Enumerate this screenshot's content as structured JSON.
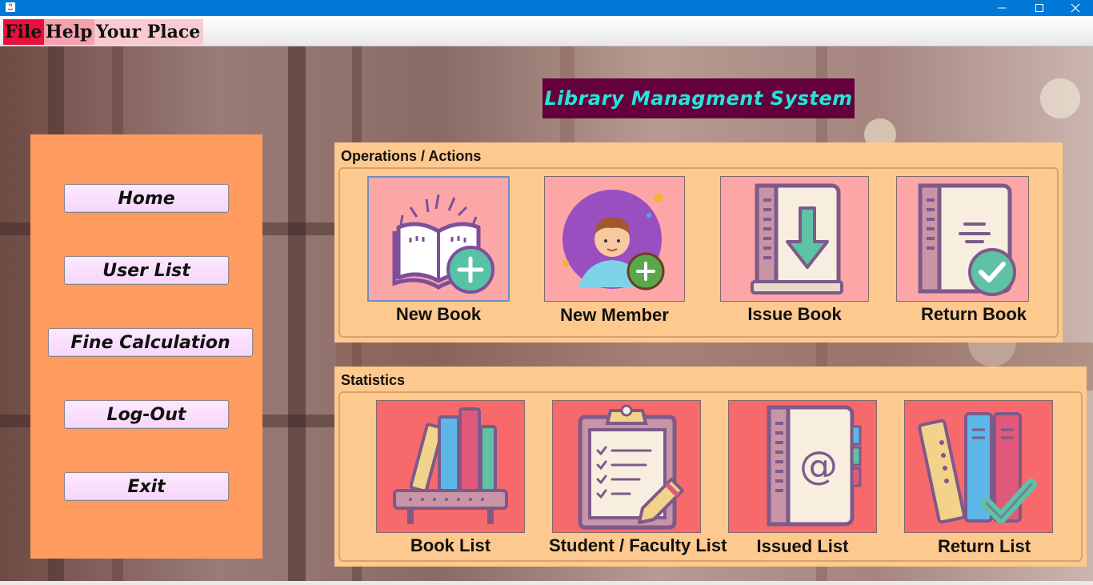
{
  "window": {
    "min_glyph": "—",
    "max_glyph": "☐",
    "close_glyph": "✕"
  },
  "menu": {
    "file": "File",
    "help": "Help",
    "your_place": "Your Place"
  },
  "app_title": "Library Managment System",
  "sidebar": {
    "home": "Home",
    "user_list": "User List",
    "fine_calculation": "Fine Calculation",
    "logout": "Log-Out",
    "exit": "Exit"
  },
  "operations": {
    "title": "Operations  /  Actions",
    "tiles": [
      {
        "label": "New Book",
        "icon": "new-book-icon"
      },
      {
        "label": "New Member",
        "icon": "new-member-icon"
      },
      {
        "label": "Issue Book",
        "icon": "issue-book-icon"
      },
      {
        "label": "Return Book",
        "icon": "return-book-icon"
      }
    ]
  },
  "statistics": {
    "title": "Statistics",
    "tiles": [
      {
        "label": "Book List",
        "icon": "book-list-icon"
      },
      {
        "label": "Student / Faculty List",
        "icon": "clipboard-list-icon"
      },
      {
        "label": "Issued List",
        "icon": "issued-list-icon"
      },
      {
        "label": "Return List",
        "icon": "return-list-icon"
      }
    ]
  },
  "colors": {
    "titlebar": "#0078d7",
    "sidebar": "#ff9b5f",
    "panel": "#fec98f",
    "title_bg": "#64003c",
    "title_text": "#27e4d7",
    "ops_tile": "#fda6a7",
    "stats_tile": "#f8696b"
  }
}
